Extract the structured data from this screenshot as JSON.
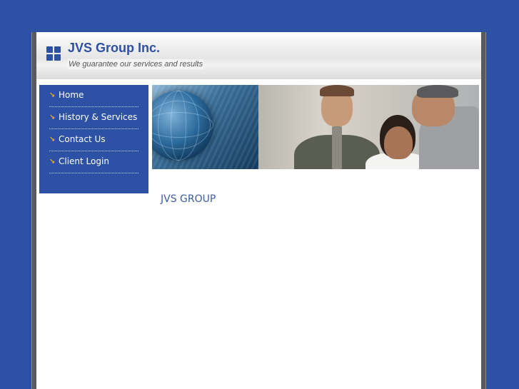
{
  "header": {
    "title": "JVS Group Inc.",
    "tagline": "We guarantee our services and results"
  },
  "nav": {
    "items": [
      {
        "label": "Home"
      },
      {
        "label": "History & Services"
      },
      {
        "label": "Contact Us"
      },
      {
        "label": "Client Login"
      }
    ]
  },
  "main": {
    "heading": "JVS GROUP"
  },
  "colors": {
    "background": "#2d51a4",
    "accent": "#2d51a4",
    "nav_arrow": "#f0b400"
  },
  "icons": {
    "logo": "four-squares-icon",
    "nav_arrow": "arrow-down-right-icon"
  }
}
